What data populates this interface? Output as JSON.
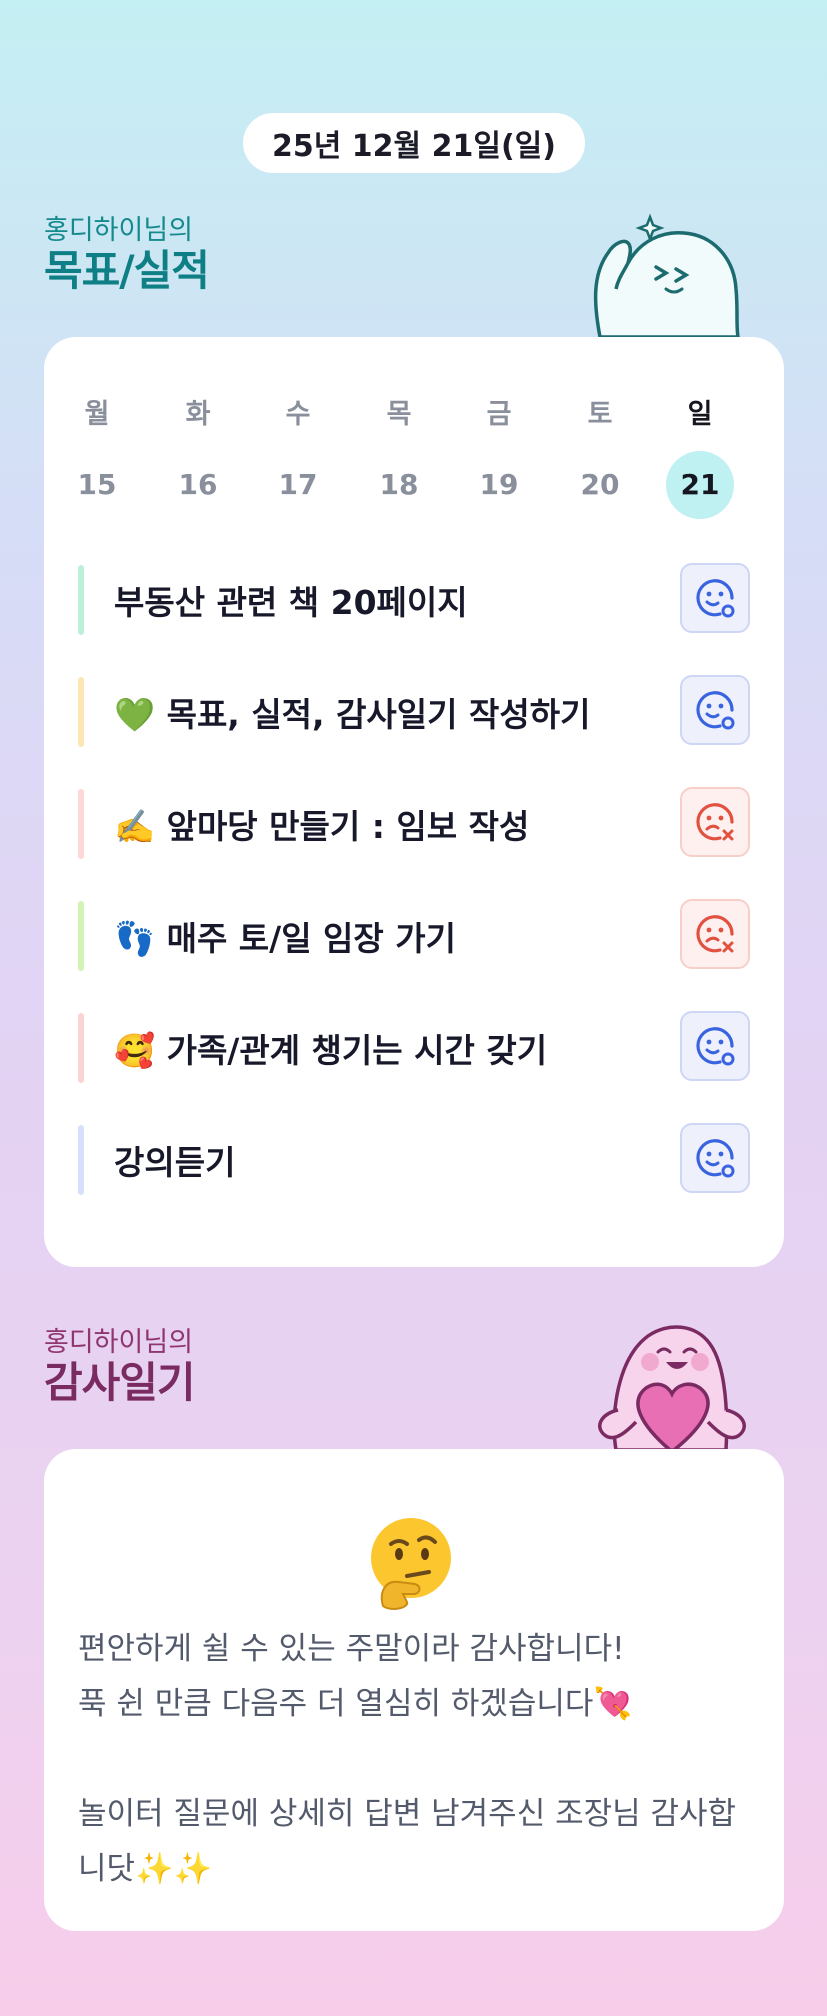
{
  "date": "25년 12월 21일(일)",
  "goals_section": {
    "owner": "홍디하이님의",
    "title": "목표/실적"
  },
  "week": [
    {
      "name": "월",
      "num": "15",
      "selected": false
    },
    {
      "name": "화",
      "num": "16",
      "selected": false
    },
    {
      "name": "수",
      "num": "17",
      "selected": false
    },
    {
      "name": "목",
      "num": "18",
      "selected": false
    },
    {
      "name": "금",
      "num": "19",
      "selected": false
    },
    {
      "name": "토",
      "num": "20",
      "selected": false
    },
    {
      "name": "일",
      "num": "21",
      "selected": true
    }
  ],
  "goals": [
    {
      "text": "부동산 관련 책 20페이지",
      "status": "done",
      "bar_color": "#bdf0d8",
      "icon": "smile-check-icon"
    },
    {
      "text": "💚 목표, 실적, 감사일기 작성하기",
      "status": "done",
      "bar_color": "#fbe6b6",
      "icon": "smile-check-icon"
    },
    {
      "text": "✍️ 앞마당 만들기 : 임보 작성",
      "status": "missed",
      "bar_color": "#fcd9d6",
      "icon": "sad-x-icon"
    },
    {
      "text": "👣 매주 토/일 임장 가기",
      "status": "missed",
      "bar_color": "#d3f3b4",
      "icon": "sad-x-icon"
    },
    {
      "text": "🥰 가족/관계 챙기는 시간 갖기",
      "status": "done",
      "bar_color": "#fbd3d3",
      "icon": "smile-check-icon"
    },
    {
      "text": "강의듣기",
      "status": "done",
      "bar_color": "#d6e0fa",
      "icon": "smile-check-icon"
    }
  ],
  "gratitude_section": {
    "owner": "홍디하이님의",
    "title": "감사일기"
  },
  "gratitude": {
    "emoji": "thinking-face-icon",
    "text": "편안하게 쉴 수 있는 주말이라 감사합니다!\n푹 쉰 만큼 다음주 더 열심히 하겠습니다💘\n\n놀이터 질문에 상세히 답변 남겨주신 조장님 감사합니닷✨✨"
  },
  "colors": {
    "accent_teal": "#0f7f86",
    "accent_plum": "#7a2b62",
    "done_icon": "#3a63e0",
    "missed_icon": "#e25040",
    "selected_day_bg": "#bff0f2"
  }
}
